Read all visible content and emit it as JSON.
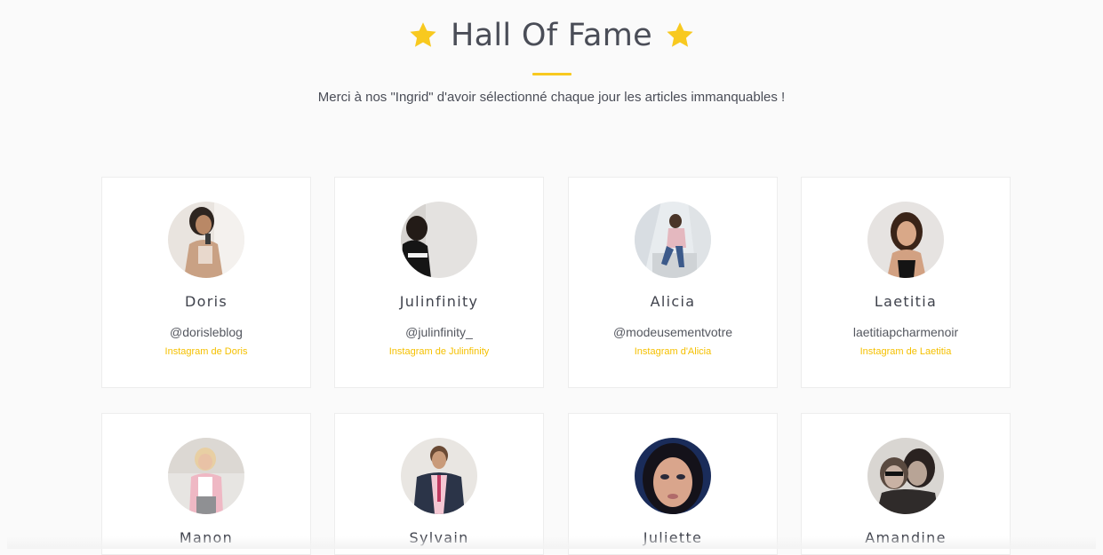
{
  "header": {
    "title": "Hall Of Fame",
    "subtitle": "Merci à nos \"Ingrid\" d'avoir sélectionné chaque jour les articles immanquables !"
  },
  "colors": {
    "accent": "#f8c91f",
    "link": "#f5c000",
    "text": "#4a4d57"
  },
  "icons": {
    "left_star": "star-icon",
    "right_star": "star-icon"
  },
  "cards": [
    {
      "name": "Doris",
      "handle": "@dorisleblog",
      "link": "Instagram de Doris"
    },
    {
      "name": "Julinfinity",
      "handle": "@julinfinity_",
      "link": "Instagram de Julinfinity"
    },
    {
      "name": "Alicia",
      "handle": "@modeusementvotre",
      "link": "Instagram d'Alicia"
    },
    {
      "name": "Laetitia",
      "handle": "laetitiapcharmenoir",
      "link": "Instagram de Laetitia"
    },
    {
      "name": "Manon"
    },
    {
      "name": "Sylvain"
    },
    {
      "name": "Juliette"
    },
    {
      "name": "Amandine"
    }
  ]
}
